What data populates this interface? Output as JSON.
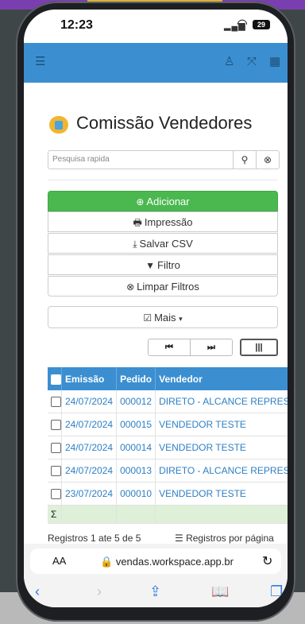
{
  "status": {
    "time": "12:23",
    "battery": "29"
  },
  "topbar": {
    "menu_icon": "hamburger-icon",
    "user_icon": "user-icon",
    "collapse_icon": "compress-icon",
    "grid_icon": "grid-icon"
  },
  "page": {
    "title": "Comissão Vendedores",
    "search_placeholder": "Pesquisa rapida"
  },
  "actions": {
    "add": "Adicionar",
    "print": "Impressão",
    "csv": "Salvar CSV",
    "filter": "Filtro",
    "clear_filters": "Limpar Filtros",
    "more": "Mais"
  },
  "pager": {
    "first": "⏮",
    "last": "⏭",
    "columns": "|||"
  },
  "table": {
    "headers": [
      "Emissão",
      "Pedido",
      "Vendedor"
    ],
    "rows": [
      {
        "emissao": "24/07/2024",
        "pedido": "000012",
        "vendedor": "DIRETO - ALCANCE REPRESENTAÇÕES"
      },
      {
        "emissao": "24/07/2024",
        "pedido": "000015",
        "vendedor": "VENDEDOR TESTE"
      },
      {
        "emissao": "24/07/2024",
        "pedido": "000014",
        "vendedor": "VENDEDOR TESTE"
      },
      {
        "emissao": "24/07/2024",
        "pedido": "000013",
        "vendedor": "DIRETO - ALCANCE REPRESENTAÇÕES"
      },
      {
        "emissao": "23/07/2024",
        "pedido": "000010",
        "vendedor": "VENDEDOR TESTE"
      }
    ],
    "sum_symbol": "Σ"
  },
  "footer": {
    "records": "Registros 1 ate 5 de 5",
    "per_page": "Registros por página"
  },
  "browser": {
    "aa": "AA",
    "url": "vendas.workspace.app.br"
  },
  "colors": {
    "accent": "#3b8fd0",
    "success": "#4bb84f",
    "sum_row": "#def0d8"
  }
}
